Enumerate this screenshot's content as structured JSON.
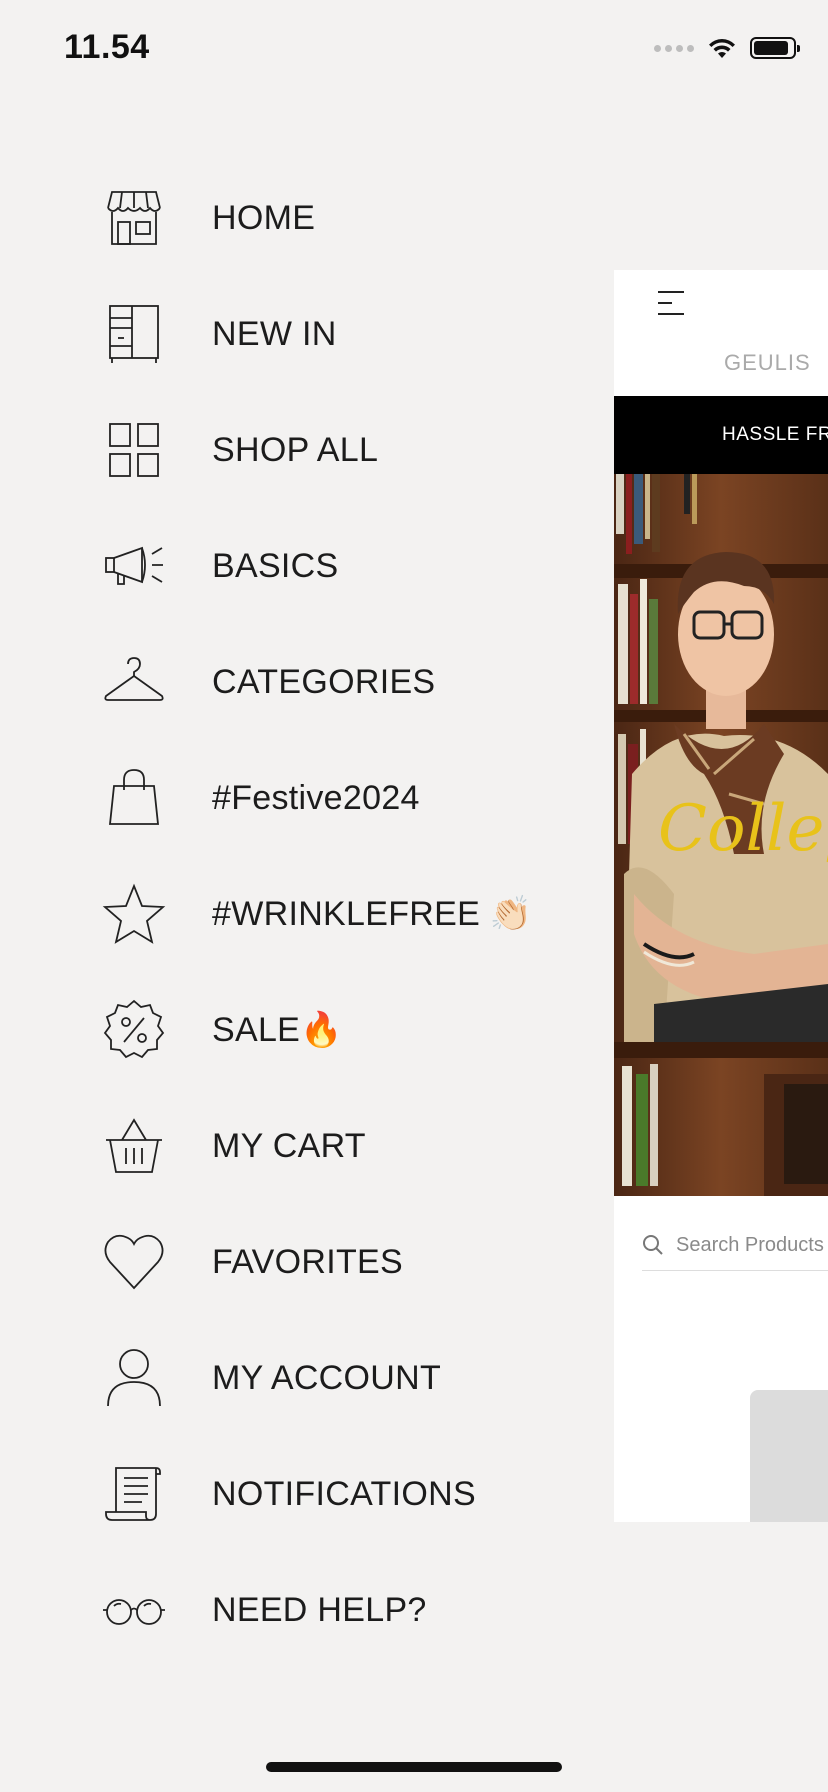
{
  "status_bar": {
    "time": "11.54"
  },
  "menu": {
    "items": [
      {
        "label": "HOME",
        "icon": "storefront-icon"
      },
      {
        "label": "NEW IN",
        "icon": "wardrobe-icon"
      },
      {
        "label": "SHOP ALL",
        "icon": "grid-icon"
      },
      {
        "label": "BASICS",
        "icon": "megaphone-icon"
      },
      {
        "label": "CATEGORIES",
        "icon": "hanger-icon"
      },
      {
        "label": "#Festive2024",
        "icon": "shopping-bag-icon"
      },
      {
        "label": "#WRINKLEFREE 👏🏻",
        "icon": "star-icon"
      },
      {
        "label": "SALE🔥",
        "icon": "discount-badge-icon"
      },
      {
        "label": "MY CART",
        "icon": "basket-icon"
      },
      {
        "label": "FAVORITES",
        "icon": "heart-icon"
      },
      {
        "label": "MY ACCOUNT",
        "icon": "user-icon"
      },
      {
        "label": "NOTIFICATIONS",
        "icon": "scroll-icon"
      },
      {
        "label": "NEED HELP?",
        "icon": "glasses-icon"
      }
    ]
  },
  "preview": {
    "brand": "GEULIS",
    "promo_text": "HASSLE FRE",
    "hero_script_text": "College",
    "search_placeholder": "Search Products"
  },
  "colors": {
    "background": "#f3f2f1",
    "text": "#1c1c1c",
    "promo_bar": "#000000",
    "hero_script": "#e8c21a"
  }
}
